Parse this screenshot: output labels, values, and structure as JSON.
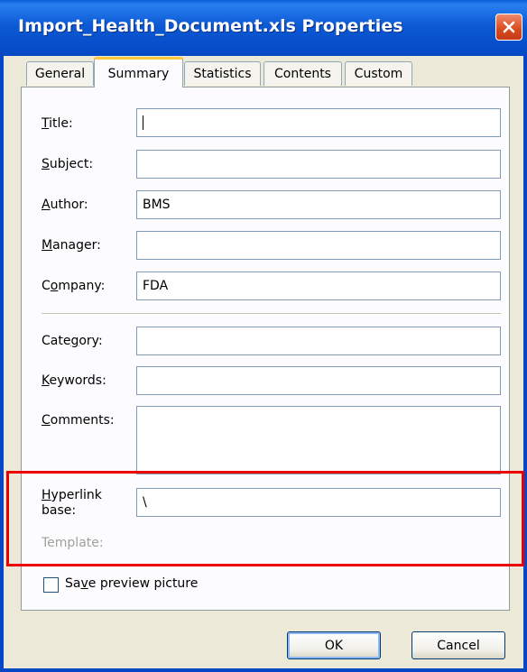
{
  "window": {
    "title": "Import_Health_Document.xls Properties"
  },
  "tabs": [
    {
      "label": "General"
    },
    {
      "label": "Summary",
      "active": true
    },
    {
      "label": "Statistics"
    },
    {
      "label": "Contents"
    },
    {
      "label": "Custom"
    }
  ],
  "fields": {
    "title": {
      "label_pre": "",
      "label_key": "T",
      "label_post": "itle:",
      "value": ""
    },
    "subject": {
      "label_pre": "",
      "label_key": "S",
      "label_post": "ubject:",
      "value": ""
    },
    "author": {
      "label_pre": "",
      "label_key": "A",
      "label_post": "uthor:",
      "value": "BMS"
    },
    "manager": {
      "label_pre": "",
      "label_key": "M",
      "label_post": "anager:",
      "value": ""
    },
    "company": {
      "label_pre": "C",
      "label_key": "o",
      "label_post": "mpany:",
      "value": "FDA"
    },
    "category": {
      "label_pre": "Cate",
      "label_key": "g",
      "label_post": "ory:",
      "value": ""
    },
    "keywords": {
      "label_pre": "",
      "label_key": "K",
      "label_post": "eywords:",
      "value": ""
    },
    "comments": {
      "label_pre": "",
      "label_key": "C",
      "label_post": "omments:",
      "value": ""
    },
    "hyperlink_base": {
      "label_key": "H",
      "label_line1_post": "yperlink",
      "label_line2": "base:",
      "value": "\\"
    },
    "template": {
      "label": "Template:"
    }
  },
  "save_preview": {
    "label_pre": "Sa",
    "label_key": "v",
    "label_post": "e preview picture",
    "checked": false
  },
  "buttons": {
    "ok": "OK",
    "cancel": "Cancel"
  },
  "colors": {
    "title_bar": "#0c59d4",
    "close_button": "#d8491f",
    "active_tab_accent": "#ffc83c",
    "highlight_box": "#ea0000"
  },
  "icons": {
    "close": "close-x-icon"
  }
}
